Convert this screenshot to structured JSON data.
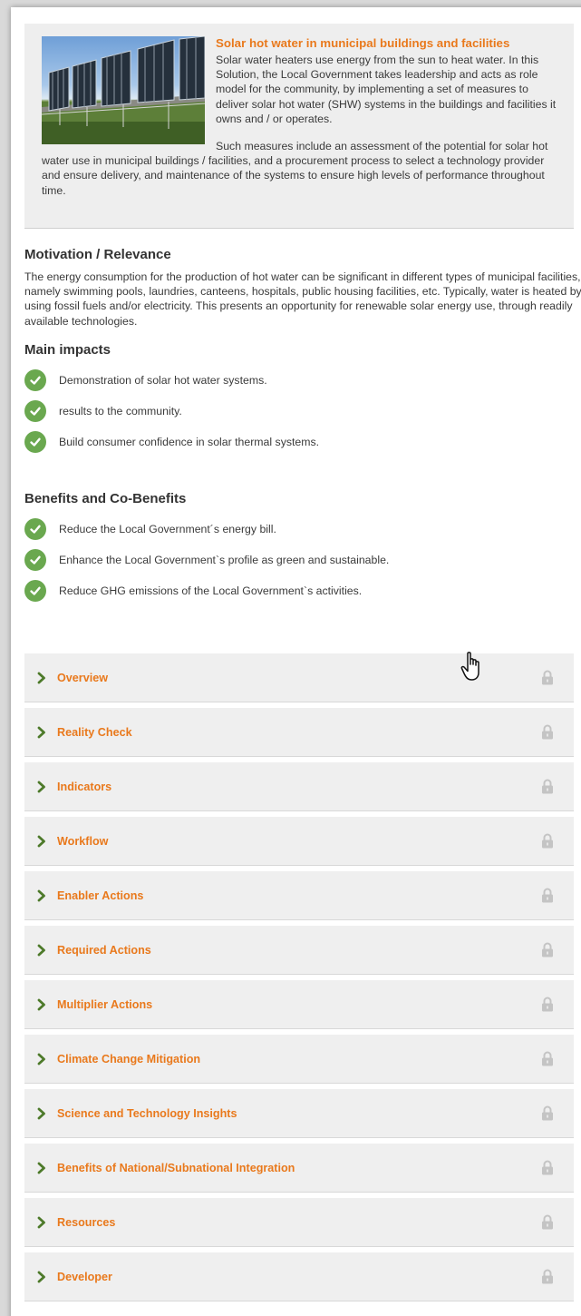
{
  "solution": {
    "title": "Solar hot water in municipal buildings and facilities",
    "paragraph1": "Solar water heaters use energy from the sun to heat water. In this Solution, the Local Government takes leadership and acts as role model for the community, by implementing a set of measures to deliver solar hot water (SHW) systems in the buildings and facilities it owns and / or operates.",
    "paragraph2": "Such measures include an assessment of the potential for solar hot water use in municipal buildings / facilities, and a procurement process to select a technology provider and ensure delivery, and maintenance of the systems to ensure high levels of performance throughout time.",
    "image_icon": "solar-collector-photo"
  },
  "motivation": {
    "heading": "Motivation / Relevance",
    "text": "The energy consumption for the production of hot water can be significant in different types of municipal facilities, namely swimming pools, laundries, canteens, hospitals, public housing facilities, etc. Typically, water is heated by using fossil fuels and/or electricity. This presents an opportunity for renewable solar energy use, through readily available technologies."
  },
  "main_impacts": {
    "heading": "Main impacts",
    "items": [
      "Demonstration of solar hot water systems.",
      "results to the community.",
      "Build consumer confidence in solar thermal systems."
    ]
  },
  "benefits": {
    "heading": "Benefits and Co-Benefits",
    "items": [
      "Reduce the Local Government´s energy bill.",
      "Enhance the Local Government`s profile as green and sustainable.",
      "Reduce GHG emissions of the Local Government`s activities."
    ]
  },
  "accordion": {
    "items": [
      "Overview",
      "Reality Check",
      "Indicators",
      "Workflow",
      "Enabler Actions",
      "Required Actions",
      "Multiplier Actions",
      "Climate Change Mitigation",
      "Science and Technology Insights",
      "Benefits of National/Subnational Integration",
      "Resources",
      "Developer"
    ],
    "chevron_icon": "chevron-right-icon",
    "lock_icon": "lock-icon"
  },
  "colors": {
    "accent": "#e9791c",
    "check": "#6aa84f",
    "panel": "#eeeeee",
    "lock": "#c4c4c4"
  }
}
